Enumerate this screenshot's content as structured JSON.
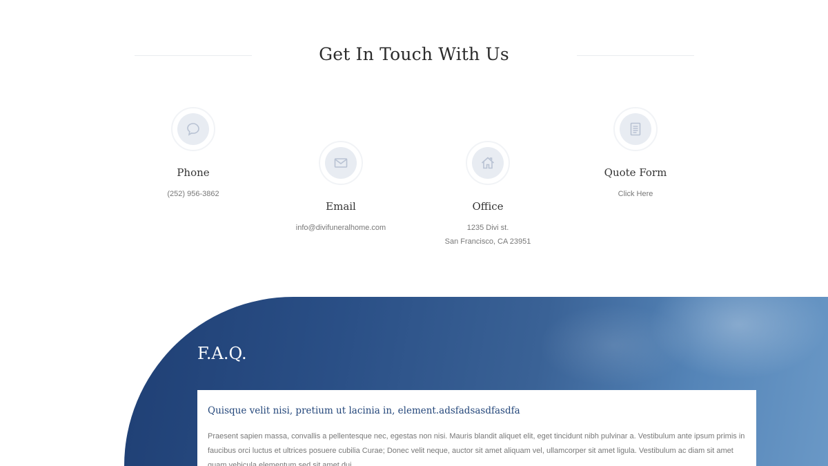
{
  "contact": {
    "title": "Get In Touch With Us",
    "cards": [
      {
        "icon": "speech-bubble-icon",
        "title": "Phone",
        "lines": [
          "(252) 956-3862"
        ]
      },
      {
        "icon": "envelope-icon",
        "title": "Email",
        "lines": [
          "info@divifuneralhome.com"
        ]
      },
      {
        "icon": "house-icon",
        "title": "Office",
        "lines": [
          "1235 Divi st.",
          "San Francisco, CA 23951"
        ]
      },
      {
        "icon": "document-icon",
        "title": "Quote Form",
        "lines": [
          "Click Here"
        ]
      }
    ]
  },
  "faq": {
    "heading": "F.A.Q.",
    "item": {
      "question": "Quisque velit nisi, pretium ut lacinia in, element.adsfadsasdfasdfa",
      "answer": "Praesent sapien massa, convallis a pellentesque nec, egestas non nisi. Mauris blandit aliquet elit, eget tincidunt nibh pulvinar a. Vestibulum ante ipsum primis in faucibus orci luctus et ultrices posuere cubilia Curae; Donec velit neque, auctor sit amet aliquam vel, ullamcorper sit amet ligula. Vestibulum ac diam sit amet quam vehicula elementum sed sit amet dui."
    }
  },
  "colors": {
    "faq_blue_dark": "#1f3f74",
    "faq_blue_light": "#6a98c6",
    "question_text": "#23467a",
    "icon_disc": "#e8ecf2"
  }
}
